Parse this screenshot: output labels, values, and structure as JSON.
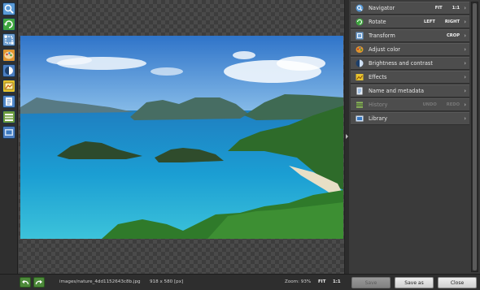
{
  "toolbar": {
    "tools": [
      {
        "icon": "magnifier-icon",
        "color": "#5a9ad6"
      },
      {
        "icon": "rotate-icon",
        "color": "#3fa63f"
      },
      {
        "icon": "transform-icon",
        "color": "#6f9fd0"
      },
      {
        "icon": "palette-icon",
        "color": "#e0952e"
      },
      {
        "icon": "brightness-icon",
        "color": "#4a7dc0"
      },
      {
        "icon": "effects-icon",
        "color": "#e7c42e"
      },
      {
        "icon": "info-icon",
        "color": "#4f86c8"
      },
      {
        "icon": "history-icon",
        "color": "#6c9c3d"
      },
      {
        "icon": "library-icon",
        "color": "#4a7cc0"
      }
    ]
  },
  "panel": {
    "items": [
      {
        "label": "Navigator",
        "icon": "navigator-icon",
        "buttons": [
          "FIT",
          "1:1"
        ]
      },
      {
        "label": "Rotate",
        "icon": "rotate-icon",
        "buttons": [
          "LEFT",
          "RIGHT"
        ]
      },
      {
        "label": "Transform",
        "icon": "transform-icon",
        "buttons": [
          "CROP"
        ]
      },
      {
        "label": "Adjust color",
        "icon": "palette-icon",
        "buttons": []
      },
      {
        "label": "Brightness and contrast",
        "icon": "brightness-icon",
        "buttons": []
      },
      {
        "label": "Effects",
        "icon": "effects-icon",
        "buttons": []
      },
      {
        "label": "Name and metadata",
        "icon": "info-icon",
        "buttons": []
      },
      {
        "label": "History",
        "icon": "history-icon",
        "buttons": [
          "UNDO",
          "REDO"
        ]
      },
      {
        "label": "Library",
        "icon": "library-icon",
        "buttons": []
      }
    ]
  },
  "status": {
    "filename": "images/nature_4dd1152643c8b.jpg",
    "dimensions": "918 x 580 [px]",
    "zoom_label": "Zoom: 93%",
    "fit": "FIT",
    "one_to_one": "1:1"
  },
  "actions": {
    "save": "Save",
    "save_as": "Save as",
    "close": "Close"
  },
  "colors": {
    "panel_row": "#4d4d4d",
    "background": "#3c3c3c",
    "undo_green": "#4d8a3a"
  }
}
